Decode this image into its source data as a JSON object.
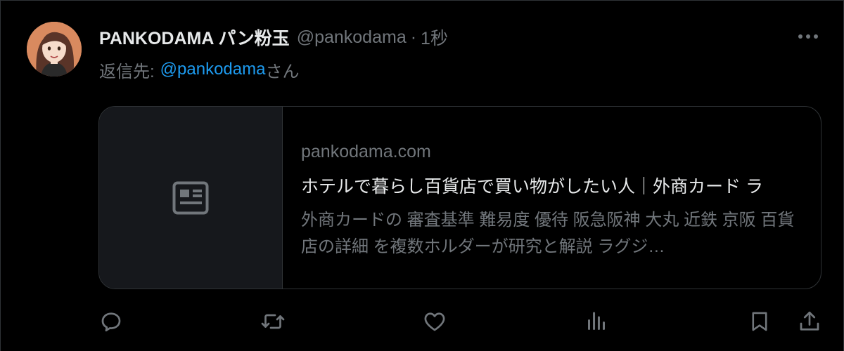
{
  "tweet": {
    "display_name": "PANKODAMA パン粉玉",
    "handle": "@pankodama",
    "separator": "·",
    "time": "1秒",
    "reply_prefix": "返信先:",
    "reply_handle": "@pankodama",
    "reply_suffix": "さん"
  },
  "card": {
    "domain": "pankodama.com",
    "title": "ホテルで暮らし百貨店で買い物がしたい人｜外商カード ラ",
    "description": "外商カードの 審査基準 難易度 優待 阪急阪神 大丸 近鉄 京阪 百貨店の詳細 を複数ホルダーが研究と解説 ラグジ…"
  },
  "icons": {
    "more": "more-horizontal-icon",
    "thumb": "news-article-icon",
    "reply": "reply-icon",
    "retweet": "retweet-icon",
    "like": "heart-icon",
    "views": "analytics-icon",
    "bookmark": "bookmark-icon",
    "share": "share-icon"
  },
  "colors": {
    "background": "#000000",
    "text": "#e7e9ea",
    "muted": "#71767b",
    "link": "#1d9bf0",
    "border": "#2f3336",
    "card_thumb": "#16181c"
  }
}
